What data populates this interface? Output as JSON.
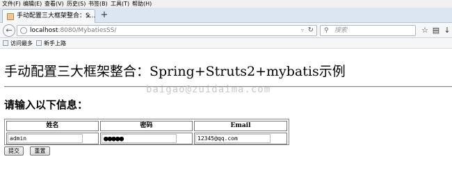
{
  "menubar": {
    "items": [
      "文件(F)",
      "编辑(E)",
      "查看(V)",
      "历史(S)",
      "书签(B)",
      "工具(T)",
      "帮助(H)"
    ]
  },
  "tab": {
    "title": "手动配置三大框架整合：S...",
    "close": "×",
    "favicon": "page-icon"
  },
  "newtab_label": "+",
  "nav": {
    "url_host": "localhost",
    "url_rest": ":8080/MybatiesSS/",
    "search_placeholder": "搜索",
    "icons": [
      "back-arrow-icon",
      "globe-icon",
      "reload-icon",
      "search-icon",
      "star-icon",
      "clipboard-icon",
      "download-icon"
    ]
  },
  "bookmarks": {
    "items": [
      "访问最多",
      "新手上路"
    ]
  },
  "page": {
    "heading": "手动配置三大框架整合：Spring+Struts2+mybatis示例",
    "watermark": "baigao@zuidaima.com",
    "subheading": "请输入以下信息：",
    "table": {
      "headers": [
        "姓名",
        "密码",
        "Email"
      ],
      "values": {
        "name": "admin",
        "password": "●●●●●",
        "email": "12345@qq.com"
      }
    },
    "buttons": {
      "submit": "提交",
      "reset": "重置"
    }
  },
  "colors": {
    "tabstrip": "#dbe6f2",
    "toolbar": "#f5f6f8",
    "watermark": "#c9c9c9"
  }
}
